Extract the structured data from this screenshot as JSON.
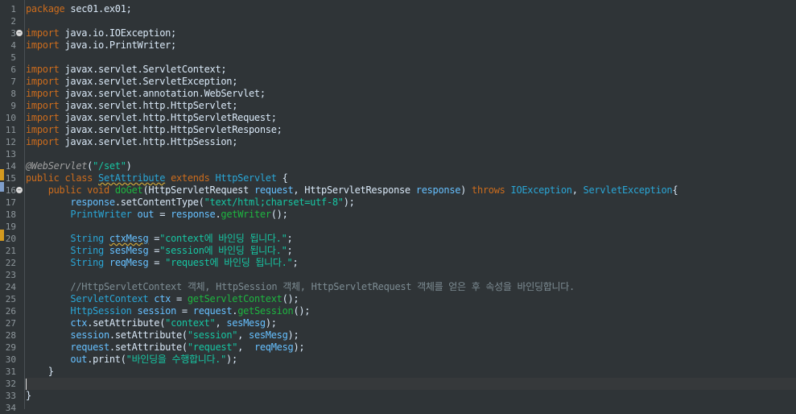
{
  "editor": {
    "line_numbers": [
      "1",
      "2",
      "3",
      "4",
      "5",
      "6",
      "7",
      "8",
      "9",
      "10",
      "11",
      "12",
      "13",
      "14",
      "15",
      "16",
      "17",
      "18",
      "19",
      "20",
      "21",
      "22",
      "23",
      "24",
      "25",
      "26",
      "27",
      "28",
      "29",
      "30",
      "31",
      "32",
      "33",
      "34"
    ],
    "lines": [
      [
        [
          "kw",
          "package"
        ],
        [
          "plain",
          " sec01.ex01;"
        ]
      ],
      [],
      [
        [
          "kw",
          "import"
        ],
        [
          "plain",
          " java.io.IOException;"
        ]
      ],
      [
        [
          "kw",
          "import"
        ],
        [
          "plain",
          " java.io.PrintWriter;"
        ]
      ],
      [],
      [
        [
          "kw",
          "import"
        ],
        [
          "plain",
          " javax.servlet.ServletContext;"
        ]
      ],
      [
        [
          "kw",
          "import"
        ],
        [
          "plain",
          " javax.servlet.ServletException;"
        ]
      ],
      [
        [
          "kw",
          "import"
        ],
        [
          "plain",
          " javax.servlet.annotation.WebServlet;"
        ]
      ],
      [
        [
          "kw",
          "import"
        ],
        [
          "plain",
          " javax.servlet.http.HttpServlet;"
        ]
      ],
      [
        [
          "kw",
          "import"
        ],
        [
          "plain",
          " javax.servlet.http.HttpServletRequest;"
        ]
      ],
      [
        [
          "kw",
          "import"
        ],
        [
          "plain",
          " javax.servlet.http.HttpServletResponse;"
        ]
      ],
      [
        [
          "kw",
          "import"
        ],
        [
          "plain",
          " javax.servlet.http.HttpSession;"
        ]
      ],
      [],
      [
        [
          "annot",
          "@WebServlet"
        ],
        [
          "plain",
          "("
        ],
        [
          "str",
          "\"/set\""
        ],
        [
          "plain",
          ")"
        ]
      ],
      [
        [
          "kw",
          "public class "
        ],
        [
          "type squiggle",
          "SetAttribute"
        ],
        [
          "kw",
          " extends "
        ],
        [
          "type",
          "HttpServlet"
        ],
        [
          "plain",
          " {"
        ]
      ],
      [
        [
          "plain",
          "    "
        ],
        [
          "kw",
          "public void "
        ],
        [
          "method",
          "doGet"
        ],
        [
          "plain",
          "(HttpServletRequest "
        ],
        [
          "var",
          "request"
        ],
        [
          "plain",
          ", HttpServletResponse "
        ],
        [
          "var",
          "response"
        ],
        [
          "plain",
          ") "
        ],
        [
          "kw",
          "throws "
        ],
        [
          "type",
          "IOException"
        ],
        [
          "plain",
          ", "
        ],
        [
          "type",
          "ServletException"
        ],
        [
          "plain",
          "{"
        ]
      ],
      [
        [
          "plain",
          "        "
        ],
        [
          "var",
          "response"
        ],
        [
          "plain",
          ".setContentType("
        ],
        [
          "str",
          "\"text/html;charset=utf-8\""
        ],
        [
          "plain",
          ");"
        ]
      ],
      [
        [
          "plain",
          "        "
        ],
        [
          "type",
          "PrintWriter "
        ],
        [
          "var",
          "out"
        ],
        [
          "plain",
          " = "
        ],
        [
          "var",
          "response"
        ],
        [
          "plain",
          "."
        ],
        [
          "method",
          "getWriter"
        ],
        [
          "plain",
          "();"
        ]
      ],
      [],
      [
        [
          "plain",
          "        "
        ],
        [
          "type",
          "String "
        ],
        [
          "var squiggle",
          "ctxMesg"
        ],
        [
          "plain",
          " ="
        ],
        [
          "str",
          "\"context에 바인딩 됩니다.\""
        ],
        [
          "plain",
          ";"
        ]
      ],
      [
        [
          "plain",
          "        "
        ],
        [
          "type",
          "String "
        ],
        [
          "var",
          "sesMesg"
        ],
        [
          "plain",
          " ="
        ],
        [
          "str",
          "\"session에 바인딩 됩니다.\""
        ],
        [
          "plain",
          ";"
        ]
      ],
      [
        [
          "plain",
          "        "
        ],
        [
          "type",
          "String "
        ],
        [
          "var",
          "reqMesg"
        ],
        [
          "plain",
          " = "
        ],
        [
          "str",
          "\"request에 바인딩 됩니다.\""
        ],
        [
          "plain",
          ";"
        ]
      ],
      [],
      [
        [
          "plain",
          "        "
        ],
        [
          "com",
          "//HttpServletContext 객체, HttpSession 객체, HttpServletRequest 객체를 얻은 후 속성을 바인딩합니다."
        ]
      ],
      [
        [
          "plain",
          "        "
        ],
        [
          "type",
          "ServletContext "
        ],
        [
          "var",
          "ctx"
        ],
        [
          "plain",
          " = "
        ],
        [
          "method",
          "getServletContext"
        ],
        [
          "plain",
          "();"
        ]
      ],
      [
        [
          "plain",
          "        "
        ],
        [
          "type",
          "HttpSession "
        ],
        [
          "var",
          "session"
        ],
        [
          "plain",
          " = "
        ],
        [
          "var",
          "request"
        ],
        [
          "plain",
          "."
        ],
        [
          "method",
          "getSession"
        ],
        [
          "plain",
          "();"
        ]
      ],
      [
        [
          "plain",
          "        "
        ],
        [
          "var",
          "ctx"
        ],
        [
          "plain",
          ".setAttribute("
        ],
        [
          "str",
          "\"context\""
        ],
        [
          "plain",
          ", "
        ],
        [
          "var",
          "sesMesg"
        ],
        [
          "plain",
          ");"
        ]
      ],
      [
        [
          "plain",
          "        "
        ],
        [
          "var",
          "session"
        ],
        [
          "plain",
          ".setAttribute("
        ],
        [
          "str",
          "\"session\""
        ],
        [
          "plain",
          ", "
        ],
        [
          "var",
          "sesMesg"
        ],
        [
          "plain",
          ");"
        ]
      ],
      [
        [
          "plain",
          "        "
        ],
        [
          "var",
          "request"
        ],
        [
          "plain",
          ".setAttribute("
        ],
        [
          "str",
          "\"request\""
        ],
        [
          "plain",
          ",  "
        ],
        [
          "var",
          "reqMesg"
        ],
        [
          "plain",
          ");"
        ]
      ],
      [
        [
          "plain",
          "        "
        ],
        [
          "var",
          "out"
        ],
        [
          "plain",
          ".print("
        ],
        [
          "str",
          "\"바인딩을 수행합니다.\""
        ],
        [
          "plain",
          ");"
        ]
      ],
      [
        [
          "plain",
          "    }"
        ]
      ],
      [],
      [
        [
          "plain",
          "}"
        ]
      ],
      []
    ]
  }
}
